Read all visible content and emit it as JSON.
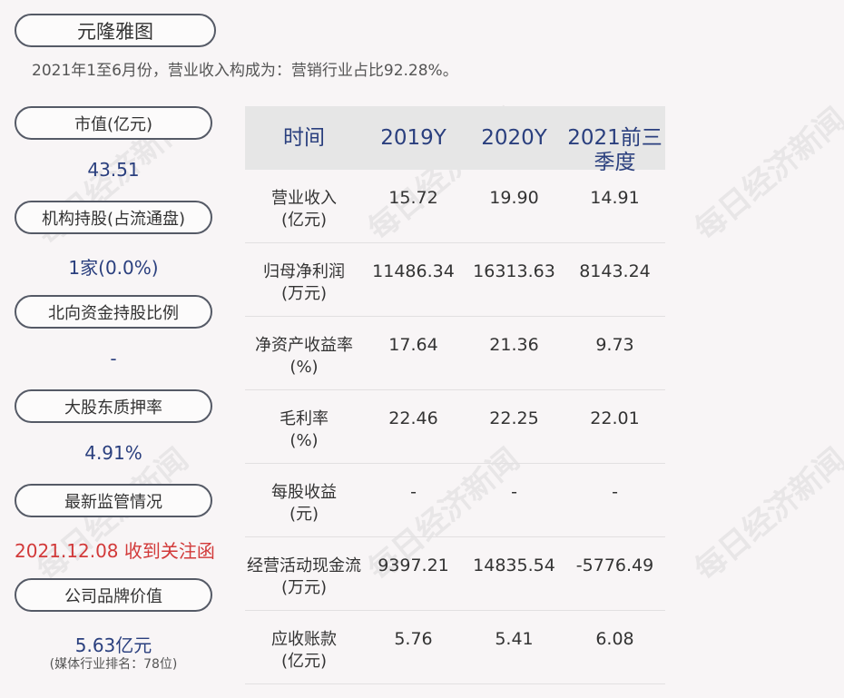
{
  "title": "元隆雅图",
  "subtitle": "2021年1至6月份，营业收入构成为：营销行业占比92.28%。",
  "watermark": "每日经济新闻",
  "sidebar": [
    {
      "label": "市值(亿元)",
      "value": "43.51"
    },
    {
      "label": "机构持股(占流通盘)",
      "value": "1家(0.0%)"
    },
    {
      "label": "北向资金持股比例",
      "value": "-"
    },
    {
      "label": "大股东质押率",
      "value": "4.91%"
    },
    {
      "label": "最新监管情况",
      "value": "2021.12.08 收到关注函"
    },
    {
      "label": "公司品牌价值",
      "value": "5.63亿元",
      "note": "(媒体行业排名：78位)"
    }
  ],
  "table": {
    "headers": [
      "时间",
      "2019Y",
      "2020Y",
      "2021前三",
      "季度"
    ],
    "rows": [
      {
        "label1": "营业收入",
        "label2": "(亿元)",
        "values": [
          "15.72",
          "19.90",
          "14.91"
        ]
      },
      {
        "label1": "归母净利润",
        "label2": "(万元)",
        "values": [
          "11486.34",
          "16313.63",
          "8143.24"
        ]
      },
      {
        "label1": "净资产收益率",
        "label2": "(%)",
        "values": [
          "17.64",
          "21.36",
          "9.73"
        ]
      },
      {
        "label1": "毛利率",
        "label2": "(%)",
        "values": [
          "22.46",
          "22.25",
          "22.01"
        ]
      },
      {
        "label1": "每股收益",
        "label2": "(元)",
        "values": [
          "-",
          "-",
          "-"
        ]
      },
      {
        "label1": "经营活动现金流",
        "label2": "(万元)",
        "values": [
          "9397.21",
          "14835.54",
          "-5776.49"
        ]
      },
      {
        "label1": "应收账款",
        "label2": "(亿元)",
        "values": [
          "5.76",
          "5.41",
          "6.08"
        ]
      }
    ]
  }
}
